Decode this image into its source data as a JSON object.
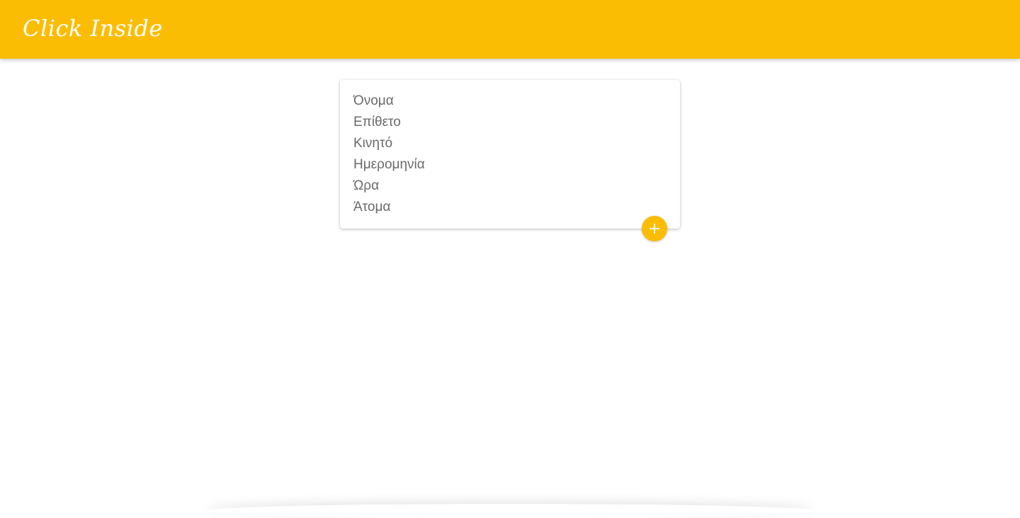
{
  "app": {
    "title": "Click Inside",
    "accent_color": "#fbbd03"
  },
  "form_card": {
    "fields": [
      {
        "label": "Όνομα"
      },
      {
        "label": "Επίθετο"
      },
      {
        "label": "Κινητό"
      },
      {
        "label": "Ημερομηνία"
      },
      {
        "label": "Ώρα"
      },
      {
        "label": "Άτομα"
      }
    ]
  },
  "add_button": {
    "icon": "plus-icon"
  }
}
